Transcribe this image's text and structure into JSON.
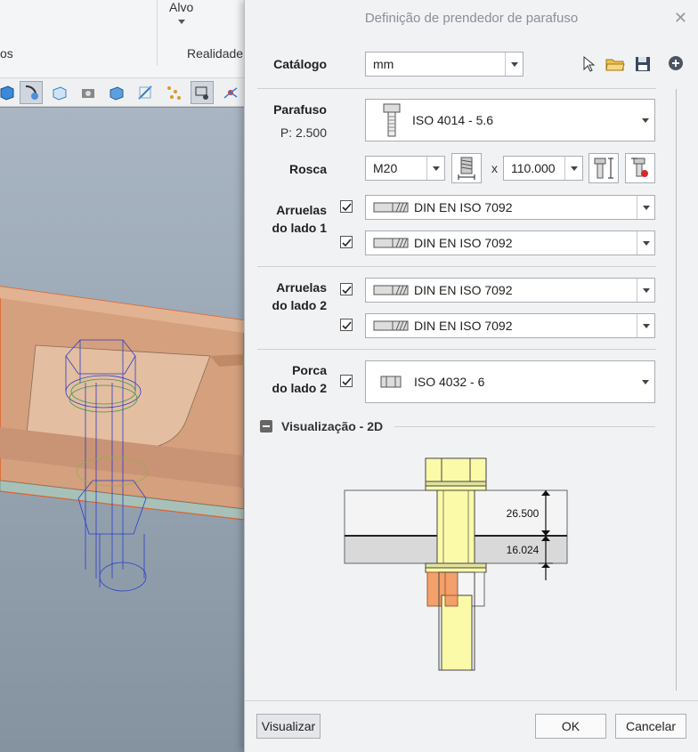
{
  "bg": {
    "alvo": "Alvo",
    "realidade": "Realidade",
    "os_fragment": "os"
  },
  "dialog": {
    "title": "Definição de prendedor de parafuso",
    "catalog_label": "Catálogo",
    "catalog_value": "mm",
    "bolt_label": "Parafuso",
    "pitch": "P: 2.500",
    "bolt_value": "ISO 4014 - 5.6",
    "thread_label": "Rosca",
    "thread_size": "M20",
    "times": "x",
    "length": "110.000",
    "washers1_label_a": "Arruelas",
    "washers1_label_b": "do lado 1",
    "washers1": [
      "DIN EN ISO 7092",
      "DIN EN ISO 7092"
    ],
    "washers2_label_a": "Arruelas",
    "washers2_label_b": "do lado 2",
    "washers2": [
      "DIN EN ISO 7092",
      "DIN EN ISO 7092"
    ],
    "nut_label_a": "Porca",
    "nut_label_b": "do lado 2",
    "nut_value": "ISO 4032 - 6",
    "preview_label": "Visualização - 2D",
    "dim_top": "26.500",
    "dim_bottom": "16.024",
    "preview_button": "Visualizar",
    "ok_button": "OK",
    "cancel_button": "Cancelar"
  }
}
